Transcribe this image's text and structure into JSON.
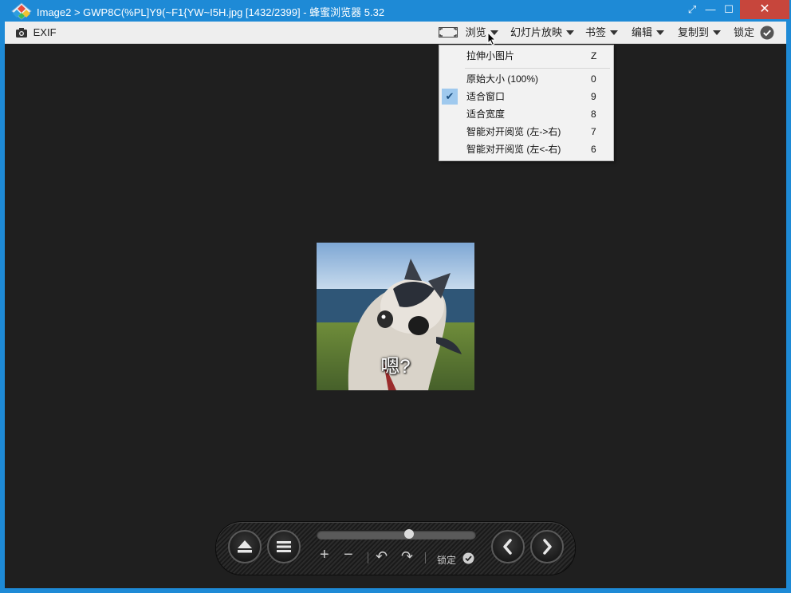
{
  "window": {
    "title": "Image2 > GWP8C(%PL]Y9(~F1{YW~I5H.jpg [1432/2399] - 蜂蜜浏览器 5.32",
    "controls": {
      "restore": "⤢",
      "minimize": "—",
      "maximize": "☐",
      "close": "✕"
    }
  },
  "toolbar": {
    "exif_label": "EXIF",
    "browse_label": "浏览",
    "slideshow_label": "幻灯片放映",
    "bookmark_label": "书签",
    "edit_label": "编辑",
    "copy_to_label": "复制到",
    "lock_label": "锁定"
  },
  "browse_menu": {
    "items": [
      {
        "label": "拉伸小图片",
        "key": "Z",
        "checked": false
      },
      {
        "label": "原始大小 (100%)",
        "key": "0",
        "checked": false
      },
      {
        "label": "适合窗口",
        "key": "9",
        "checked": true
      },
      {
        "label": "适合宽度",
        "key": "8",
        "checked": false
      },
      {
        "label": "智能对开阅览 (左->右)",
        "key": "7",
        "checked": false
      },
      {
        "label": "智能对开阅览 (左<-右)",
        "key": "6",
        "checked": false
      }
    ]
  },
  "image": {
    "caption": "嗯?"
  },
  "control_bar": {
    "zoom_in": "+",
    "zoom_out": "−",
    "rotate_left": "↶",
    "rotate_right": "↷",
    "lock_label": "锁定",
    "slider_position": 0.58
  },
  "colors": {
    "title_bar": "#1e8ad6",
    "close_button": "#c7463c",
    "viewer_background": "#1f1f1f",
    "menu_check_highlight": "#9fc9ee"
  },
  "icons": [
    "app-logo-icon",
    "camera-icon",
    "fullscreen-icon",
    "eject-icon",
    "menu-icon",
    "prev-icon",
    "next-icon",
    "check-icon",
    "cursor-icon"
  ]
}
